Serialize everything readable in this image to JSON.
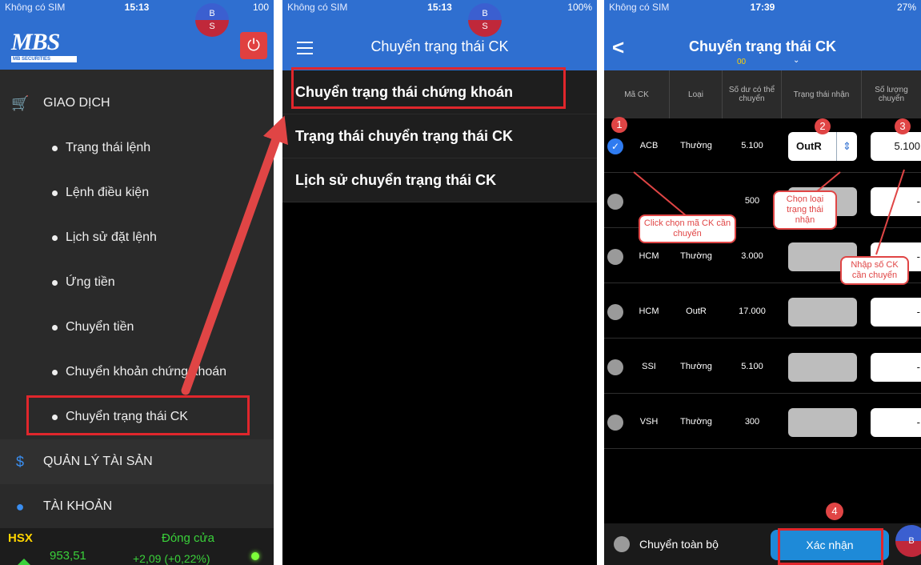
{
  "panel1": {
    "status": {
      "carrier": "Không có SIM",
      "time": "15:13",
      "battery": "100"
    },
    "bubble": {
      "top": "B",
      "bottom": "S"
    },
    "logo": "MBS",
    "logo_sub": "MB SECURITIES",
    "menu": {
      "giao_dich": "GIAO DỊCH",
      "items": [
        "Trạng thái lệnh",
        "Lệnh điều kiện",
        "Lịch sử đặt lệnh",
        "Ứng tiền",
        "Chuyển tiền",
        "Chuyển khoản chứng khoán",
        "Chuyển trạng thái CK"
      ],
      "quan_ly": "QUẢN LÝ TÀI SẢN",
      "tai_khoan": "TÀI KHOẢN"
    },
    "market": {
      "exchange": "HSX",
      "status": "Đóng cửa",
      "index": "953,51",
      "change": "+2,09 (+0,22%)"
    }
  },
  "panel2": {
    "status": {
      "carrier": "Không có SIM",
      "time": "15:13",
      "battery": "100%"
    },
    "bubble": {
      "top": "B",
      "bottom": "S"
    },
    "title": "Chuyển trạng thái CK",
    "options": [
      "Chuyển trạng thái chứng khoán",
      "Trạng thái chuyển trạng thái CK",
      "Lịch sử chuyển trạng thái CK"
    ]
  },
  "panel3": {
    "status": {
      "carrier": "Không có SIM",
      "time": "17:39",
      "battery": "27%"
    },
    "title": "Chuyển trạng thái CK",
    "account": "00",
    "headers": [
      "Mã CK",
      "Loại",
      "Số dư có thể chuyển",
      "Trạng thái nhận",
      "Số lượng chuyển"
    ],
    "rows": [
      {
        "code": "ACB",
        "type": "Thường",
        "balance": "5.100",
        "status": "OutR",
        "qty": "5.100",
        "checked": true
      },
      {
        "code": "",
        "type": "",
        "balance": "500",
        "status": "",
        "qty": "-",
        "checked": false
      },
      {
        "code": "HCM",
        "type": "Thường",
        "balance": "3.000",
        "status": "",
        "qty": "-",
        "checked": false
      },
      {
        "code": "HCM",
        "type": "OutR",
        "balance": "17.000",
        "status": "",
        "qty": "-",
        "checked": false
      },
      {
        "code": "SSI",
        "type": "Thường",
        "balance": "5.100",
        "status": "",
        "qty": "-",
        "checked": false
      },
      {
        "code": "VSH",
        "type": "Thường",
        "balance": "300",
        "status": "",
        "qty": "-",
        "checked": false
      }
    ],
    "footer": {
      "transfer_all": "Chuyển toàn bộ",
      "confirm": "Xác nhận",
      "bubble": "B"
    },
    "annotations": {
      "n1": "1",
      "n2": "2",
      "n3": "3",
      "n4": "4",
      "click_select": "Click chọn mã CK cần chuyển",
      "choose_status": "Chọn loại trạng thái nhận",
      "enter_qty": "Nhập số CK cần chuyển"
    }
  },
  "colors": {
    "brand_blue": "#2f6fd0",
    "highlight_red": "#e0262c",
    "annotation_red": "#e04545",
    "market_green": "#3ad13a"
  }
}
